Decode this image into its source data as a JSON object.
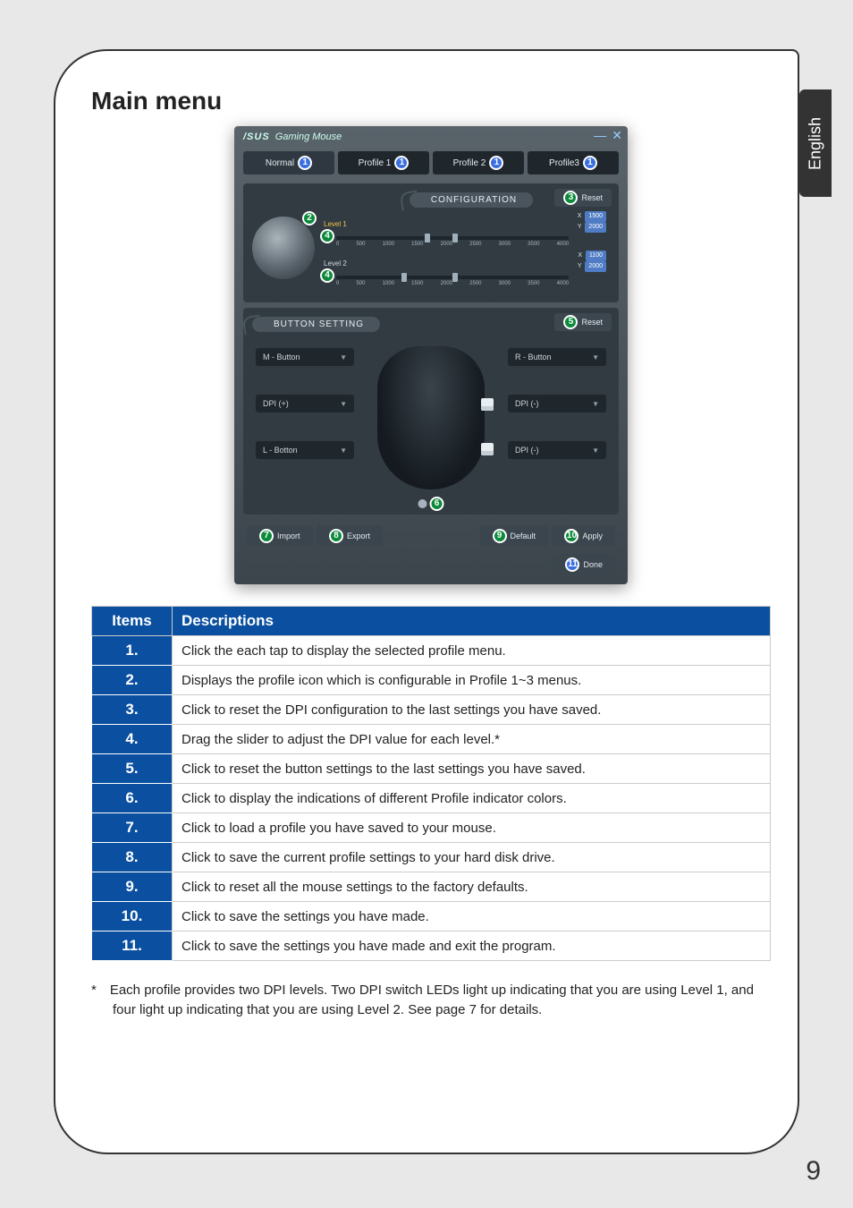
{
  "page": {
    "title": "Main menu",
    "language_tab": "English",
    "page_number": "9"
  },
  "screenshot": {
    "window_title": "Gaming Mouse",
    "tabs": {
      "normal": "Normal",
      "profile1": "Profile 1",
      "profile2": "Profile 2",
      "profile3": "Profile3"
    },
    "config": {
      "heading": "CONFIGURATION",
      "reset": "Reset",
      "level1": "Level 1",
      "level2": "Level 2",
      "ticks": [
        "0",
        "500",
        "1000",
        "1500",
        "2000",
        "2500",
        "3000",
        "3500",
        "4000"
      ],
      "l1x": "1500",
      "l1y": "2000",
      "l2x": "1100",
      "l2y": "2000"
    },
    "button_setting": {
      "heading": "BUTTON SETTING",
      "reset": "Reset",
      "left": {
        "a": "M - Button",
        "b": "DPI (+)",
        "c": "L - Botton"
      },
      "right": {
        "a": "R - Button",
        "b": "DPI (-)",
        "c": "DPI (-)"
      }
    },
    "footer": {
      "import": "Import",
      "export": "Export",
      "default": "Default",
      "apply": "Apply",
      "done": "Done"
    },
    "callouts": {
      "c1": "1",
      "c2": "2",
      "c3": "3",
      "c4": "4",
      "c5": "5",
      "c6": "6",
      "c7": "7",
      "c8": "8",
      "c9": "9",
      "c10": "10",
      "c11": "11"
    }
  },
  "table": {
    "head_items": "Items",
    "head_desc": "Descriptions",
    "rows": [
      {
        "n": "1.",
        "d": "Click the each tap to display the selected profile menu."
      },
      {
        "n": "2.",
        "d": "Displays the profile icon which is configurable in Profile 1~3 menus."
      },
      {
        "n": "3.",
        "d": "Click to reset the DPI configuration to the last settings you have saved."
      },
      {
        "n": "4.",
        "d": "Drag the slider to adjust the DPI value for each level.*"
      },
      {
        "n": "5.",
        "d": "Click to reset the button settings to the last settings you have saved."
      },
      {
        "n": "6.",
        "d": "Click to display the indications of different Profile indicator colors."
      },
      {
        "n": "7.",
        "d": "Click to load a profile you have saved to your mouse."
      },
      {
        "n": "8.",
        "d": "Click to save the current profile settings to your hard disk drive."
      },
      {
        "n": "9.",
        "d": "Click to reset all the mouse settings to the factory defaults."
      },
      {
        "n": "10.",
        "d": "Click to save the settings you have made."
      },
      {
        "n": "11.",
        "d": "Click to save the settings you have made and exit the program."
      }
    ]
  },
  "footnote": "* Each profile provides two DPI levels. Two DPI switch LEDs light up indicating that you are using Level 1, and four light up indicating that you are using Level 2. See page 7 for details."
}
